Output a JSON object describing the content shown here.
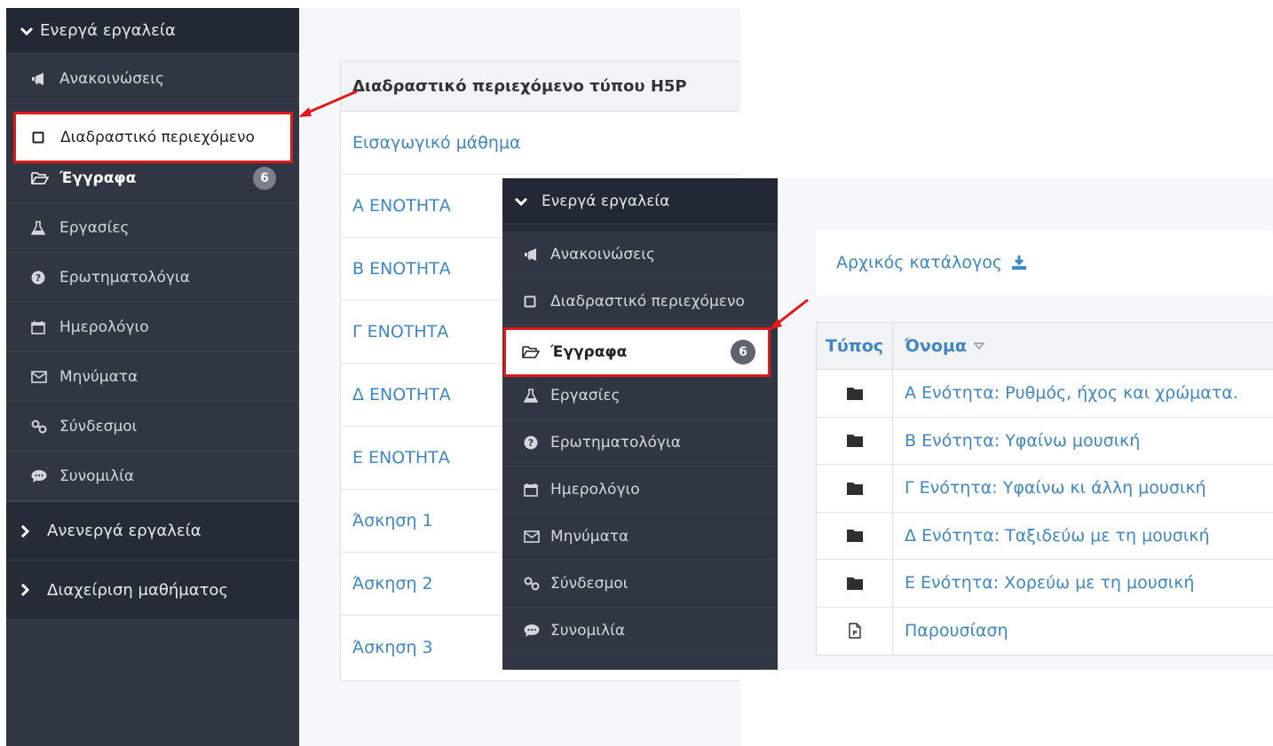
{
  "sidebar": {
    "header": "Ενεργά εργαλεία",
    "items": [
      {
        "label": "Ανακοινώσεις",
        "icon": "bullhorn-icon"
      },
      {
        "label": "Διαδραστικό περιεχόμενο",
        "icon": "square-icon"
      },
      {
        "label": "Έγγραφα",
        "icon": "folder-open-icon",
        "badge": "6"
      },
      {
        "label": "Εργασίες",
        "icon": "flask-icon"
      },
      {
        "label": "Ερωτηματολόγια",
        "icon": "question-circle-icon"
      },
      {
        "label": "Ημερολόγιο",
        "icon": "calendar-icon"
      },
      {
        "label": "Μηνύματα",
        "icon": "envelope-icon"
      },
      {
        "label": "Σύνδεσμοι",
        "icon": "link-icon"
      },
      {
        "label": "Συνομιλία",
        "icon": "comment-icon"
      }
    ],
    "sections": [
      "Ανενεργά εργαλεία",
      "Διαχείριση μαθήματος"
    ]
  },
  "h5p_table": {
    "header": "Διαδραστικό περιεχόμενο τύπου H5P",
    "rows": [
      "Εισαγωγικό μάθημα",
      "Α ΕΝΟΤΗΤΑ",
      "Β ΕΝΟΤΗΤΑ",
      "Γ ΕΝΟΤΗΤΑ",
      "Δ ΕΝΟΤΗΤΑ",
      "Ε ΕΝΟΤΗΤΑ",
      "Άσκηση 1",
      "Άσκηση 2",
      "Άσκηση 3"
    ]
  },
  "panel2": {
    "header": "Ενεργά εργαλεία",
    "items": [
      {
        "label": "Ανακοινώσεις"
      },
      {
        "label": "Διαδραστικό περιεχόμενο"
      },
      {
        "label": "Έγγραφα",
        "badge": "6"
      },
      {
        "label": "Εργασίες"
      },
      {
        "label": "Ερωτηματολόγια"
      },
      {
        "label": "Ημερολόγιο"
      },
      {
        "label": "Μηνύματα"
      },
      {
        "label": "Σύνδεσμοι"
      },
      {
        "label": "Συνομιλία"
      }
    ]
  },
  "documents": {
    "root_label": "Αρχικός κατάλογος",
    "col_type": "Τύπος",
    "col_name": "Όνομα",
    "rows": [
      {
        "name": "Α Ενότητα: Ρυθμός, ήχος και χρώματα.",
        "icon": "folder-icon"
      },
      {
        "name": "Β Ενότητα: Υφαίνω μουσική",
        "icon": "folder-icon"
      },
      {
        "name": "Γ Ενότητα: Υφαίνω κι άλλη μουσική",
        "icon": "folder-icon"
      },
      {
        "name": "Δ Ενότητα: Ταξιδεύω με τη μουσική",
        "icon": "folder-icon"
      },
      {
        "name": "Ε Ενότητα: Χορεύω με τη μουσική",
        "icon": "folder-icon"
      },
      {
        "name": "Παρουσίαση",
        "icon": "powerpoint-file-icon"
      }
    ]
  },
  "colors": {
    "highlight": "#e01a1a",
    "link": "#3f87c4",
    "sidebar": "#303642"
  }
}
